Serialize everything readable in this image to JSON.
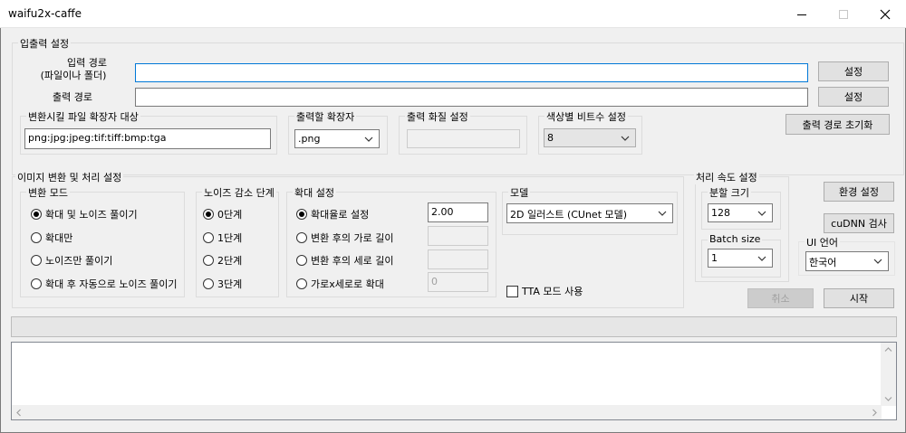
{
  "window": {
    "title": "waifu2x-caffe"
  },
  "io": {
    "group": "입출력 설정",
    "input_label_line1": "입력 경로",
    "input_label_line2": "(파일이나 폴더)",
    "input_value": "",
    "output_label": "출력 경로",
    "output_value": "",
    "set_button": "설정",
    "set_button2": "설정",
    "ext_group": "변환시킬 파일 확장자 대상",
    "ext_value": "png:jpg:jpeg:tif:tiff:bmp:tga",
    "out_ext_group": "출력할 확장자",
    "out_ext_value": ".png",
    "quality_group": "출력 화질 설정",
    "bits_group": "색상별 비트수 설정",
    "bits_value": "8",
    "reset_output_button": "출력 경로 초기화"
  },
  "conversion": {
    "group": "이미지 변환 및 처리 설정",
    "mode_group": "변환 모드",
    "modes": [
      "확대 및 노이즈 풀이기",
      "확대만",
      "노이즈만 풀이기",
      "확대 후 자동으로 노이즈 풀이기"
    ],
    "selected_mode": 0,
    "noise_group": "노이즈 감소 단계",
    "noise_levels": [
      "0단계",
      "1단계",
      "2단계",
      "3단계"
    ],
    "selected_noise": 0,
    "scale_group": "확대 설정",
    "scale_options": [
      "확대율로 설정",
      "변환 후의 가로 길이",
      "변환 후의 세로 길이",
      "가로x세로로 확대"
    ],
    "selected_scale": 0,
    "scale_ratio": "2.00",
    "scale_width": "",
    "scale_height": "",
    "scale_wh": "0",
    "model_group": "모델",
    "model_value": "2D 일러스트 (CUnet 모델)",
    "tta_label": "TTA 모드 사용"
  },
  "speed": {
    "group": "처리 속도 설정",
    "split_group": "분할 크기",
    "split_value": "128",
    "batch_group": "Batch size",
    "batch_value": "1",
    "env_button": "환경 설정",
    "cudnn_button": "cuDNN 검사",
    "ui_lang_group": "UI 언어",
    "ui_lang_value": "한국어",
    "cancel_button": "취소",
    "start_button": "시작"
  },
  "progress": {
    "value": 0
  },
  "log": {
    "text": ""
  }
}
